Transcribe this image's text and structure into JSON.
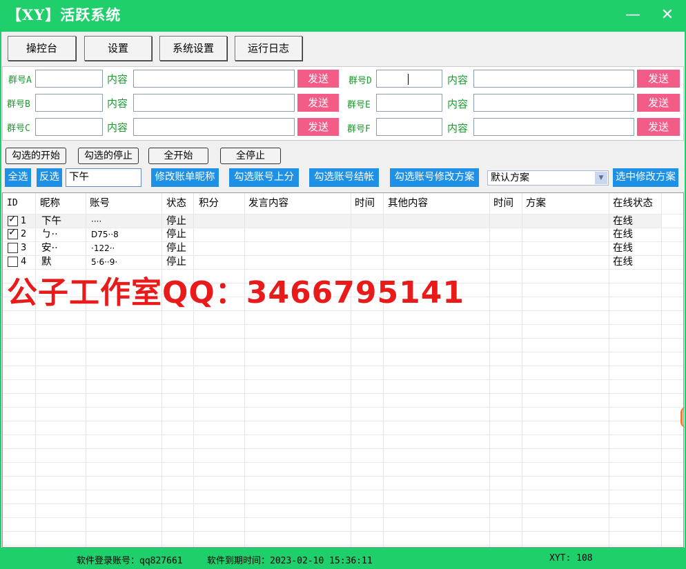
{
  "window": {
    "title": "【XY】活跃系统",
    "minimize": "—",
    "close": "✕"
  },
  "top_buttons": [
    "操控台",
    "设置",
    "系统设置",
    "运行日志"
  ],
  "groups": {
    "content_label": "内容",
    "send_label": "发送",
    "left": [
      {
        "label": "群号A",
        "group": "",
        "content": ""
      },
      {
        "label": "群号B",
        "group": "",
        "content": ""
      },
      {
        "label": "群号C",
        "group": "",
        "content": ""
      }
    ],
    "right": [
      {
        "label": "群号D",
        "group": "",
        "content": ""
      },
      {
        "label": "群号E",
        "group": "",
        "content": ""
      },
      {
        "label": "群号F",
        "group": "",
        "content": ""
      }
    ]
  },
  "controls": {
    "start_checked": "勾选的开始",
    "stop_checked": "勾选的停止",
    "start_all": "全开始",
    "stop_all": "全停止",
    "select_all": "全选",
    "invert": "反选",
    "filter_value": "下午",
    "rename_nick": "修改账单昵称",
    "add_points": "勾选账号上分",
    "settle": "勾选账号结帐",
    "change_scheme": "勾选账号修改方案",
    "scheme_selected": "默认方案",
    "apply_scheme": "选中修改方案"
  },
  "table": {
    "columns": [
      "ID",
      "昵称",
      "账号",
      "状态",
      "积分",
      "发言内容",
      "时间",
      "其他内容",
      "时间",
      "方案",
      "在线状态"
    ],
    "rows": [
      {
        "checked": true,
        "id": "1",
        "nick": "下午",
        "account": "····",
        "status": "停止",
        "online": "在线"
      },
      {
        "checked": true,
        "id": "2",
        "nick": "ㄅ··",
        "account": "D75··8",
        "status": "停止",
        "online": "在线"
      },
      {
        "checked": false,
        "id": "3",
        "nick": "安··",
        "account": "·122··",
        "status": "停止",
        "online": "在线"
      },
      {
        "checked": false,
        "id": "4",
        "nick": "默",
        "account": "5·6··9·",
        "status": "停止",
        "online": "在线"
      }
    ]
  },
  "watermark": "公子工作室QQ：3466795141",
  "status_bar": {
    "login": "软件登录账号：qq827661",
    "expiry": "软件到期时间：2023-02-10 15:36:11",
    "xyt": "XYT:  108"
  },
  "colors": {
    "accent": "#1fcf6c",
    "send": "#f25c87",
    "action": "#1e90e6",
    "watermark": "#e81a1a",
    "label_green": "#1a9c2e"
  }
}
